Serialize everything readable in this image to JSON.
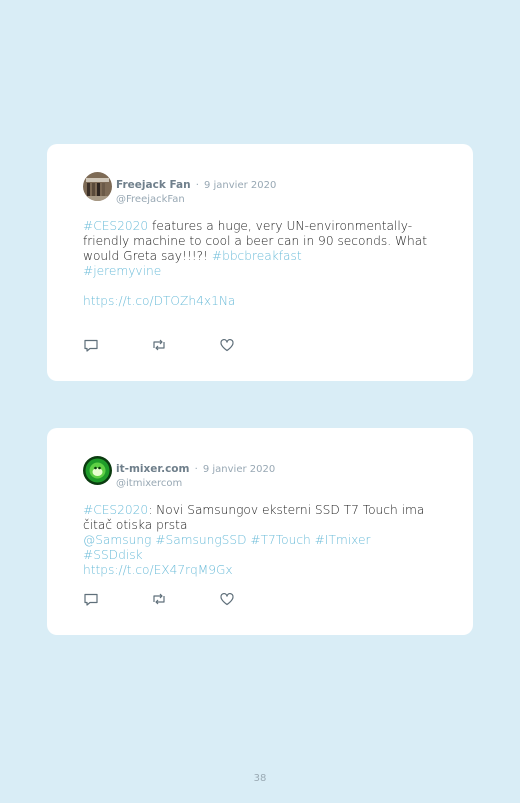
{
  "tweets": [
    {
      "author": "Freejack Fan",
      "separator": "·",
      "date": "9 janvier 2020",
      "handle": "@FreejackFan",
      "tag1": "#CES2020",
      "text1": " features a huge, very UN-environmentally-friendly machine to cool a beer can in 90 seconds. What would Greta say!!!?! ",
      "tag2": "#bbcbreakfast",
      "tag3": "#jeremyvine",
      "link": "https://t.co/DTOZh4x1Na",
      "avatar_icon": "profile-photo"
    },
    {
      "author": "it-mixer.com",
      "separator": "·",
      "date": "9 janvier 2020",
      "handle": "@itmixercom",
      "tag1": "#CES2020",
      "text1": ": Novi Samsungov eksterni SSD T7 Touch ima čitač otiska prsta",
      "mentions": "@Samsung #SamsungSSD #T7Touch #ITmixer #SSDdisk",
      "link": "https://t.co/EX47rqM9Gx",
      "avatar_icon": "green-logo"
    }
  ],
  "icons": [
    "reply-icon",
    "retweet-icon",
    "like-icon"
  ],
  "colors": {
    "background": "#d9edf6",
    "link": "#6cbcd9",
    "meta": "#98a8b4"
  },
  "page_number": "38"
}
